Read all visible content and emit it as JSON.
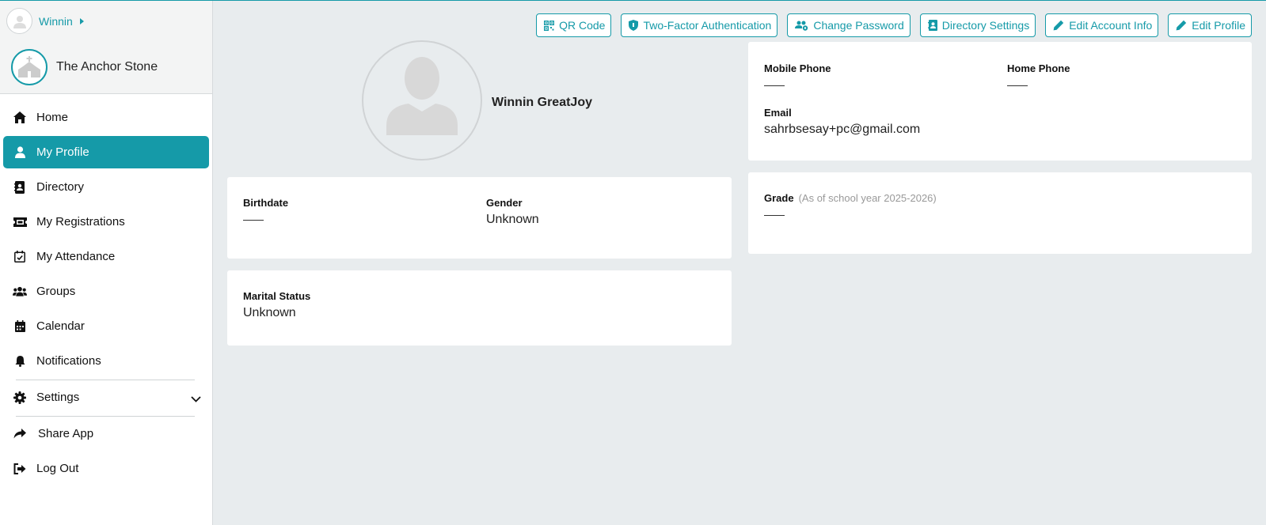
{
  "sidebar": {
    "user": {
      "name": "Winnin"
    },
    "church": {
      "name": "The Anchor Stone"
    },
    "nav": {
      "home": "Home",
      "my_profile": "My Profile",
      "directory": "Directory",
      "my_registrations": "My Registrations",
      "my_attendance": "My Attendance",
      "groups": "Groups",
      "calendar": "Calendar",
      "notifications": "Notifications",
      "settings": "Settings",
      "share_app": "Share App",
      "log_out": "Log Out"
    },
    "active_item": "my_profile"
  },
  "toolbar": {
    "qr_code": "QR Code",
    "two_factor": "Two-Factor Authentication",
    "change_password": "Change Password",
    "directory_settings": "Directory Settings",
    "edit_account_info": "Edit Account Info",
    "edit_profile": "Edit Profile"
  },
  "profile": {
    "full_name": "Winnin GreatJoy"
  },
  "contact": {
    "mobile_phone_label": "Mobile Phone",
    "home_phone_label": "Home Phone",
    "email_label": "Email",
    "email_value": "sahrbsesay+pc@gmail.com"
  },
  "personal": {
    "birthdate_label": "Birthdate",
    "gender_label": "Gender",
    "gender_value": "Unknown",
    "marital_status_label": "Marital Status",
    "marital_status_value": "Unknown"
  },
  "school": {
    "grade_label": "Grade",
    "grade_note": "(As of school year 2025-2026)"
  },
  "colors": {
    "accent": "#159aa8",
    "background": "#e8ecee"
  }
}
